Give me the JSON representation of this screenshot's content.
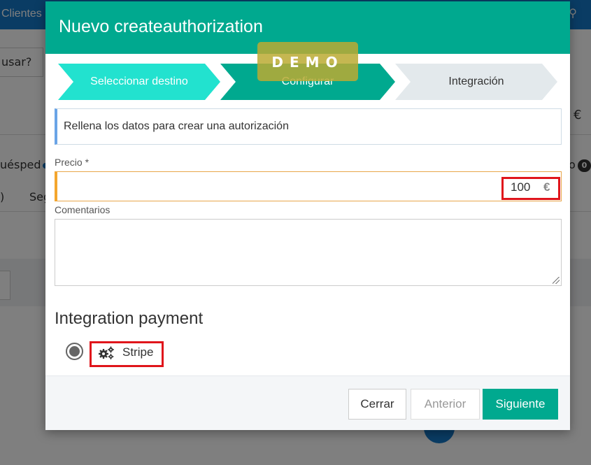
{
  "background": {
    "topbar_title": "Clientes",
    "search_partial": "usar?",
    "huesped_partial": "uésped",
    "segment_partial": "Seg",
    "paren_partial": ")",
    "euro": "€",
    "right_partial": "o",
    "badge": "0"
  },
  "modal": {
    "title": "Nuevo createauthorization",
    "steps": [
      {
        "label": "Seleccionar destino",
        "state": "done"
      },
      {
        "label": "Configurar",
        "state": "active"
      },
      {
        "label": "Integración",
        "state": "pending"
      }
    ],
    "watermark": "DEMO",
    "info_text": "Rellena los datos para crear una autorización",
    "price": {
      "label": "Precio *",
      "value": "100",
      "currency": "€"
    },
    "comments": {
      "label": "Comentarios",
      "value": ""
    },
    "integration": {
      "title": "Integration payment",
      "options": [
        {
          "label": "Stripe",
          "icon": "cogs-icon",
          "selected": true
        }
      ]
    },
    "buttons": {
      "close": "Cerrar",
      "previous": "Anterior",
      "next": "Siguiente"
    }
  },
  "colors": {
    "primary": "#00a98f",
    "step_done": "#22e2cf",
    "step_pending": "#e3e9ec",
    "highlight": "#e0151b",
    "info_border": "#6aa4e6",
    "required_border": "#f4a62d",
    "background_header": "#1479c9"
  }
}
